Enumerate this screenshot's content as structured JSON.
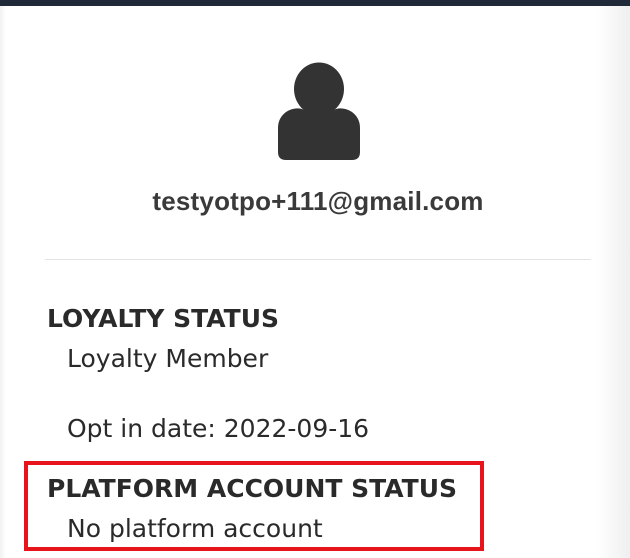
{
  "profile": {
    "avatar_icon": "user-silhouette-icon",
    "email": "testyotpo+111@gmail.com"
  },
  "loyalty": {
    "title": "LOYALTY STATUS",
    "status": "Loyalty Member",
    "opt_in": "Opt in date: 2022-09-16"
  },
  "platform": {
    "title": "PLATFORM ACCOUNT STATUS",
    "status": "No platform account"
  },
  "colors": {
    "top_bar": "#1f2937",
    "avatar": "#333333",
    "text": "#2a2a2a",
    "highlight": "#e8141b"
  }
}
